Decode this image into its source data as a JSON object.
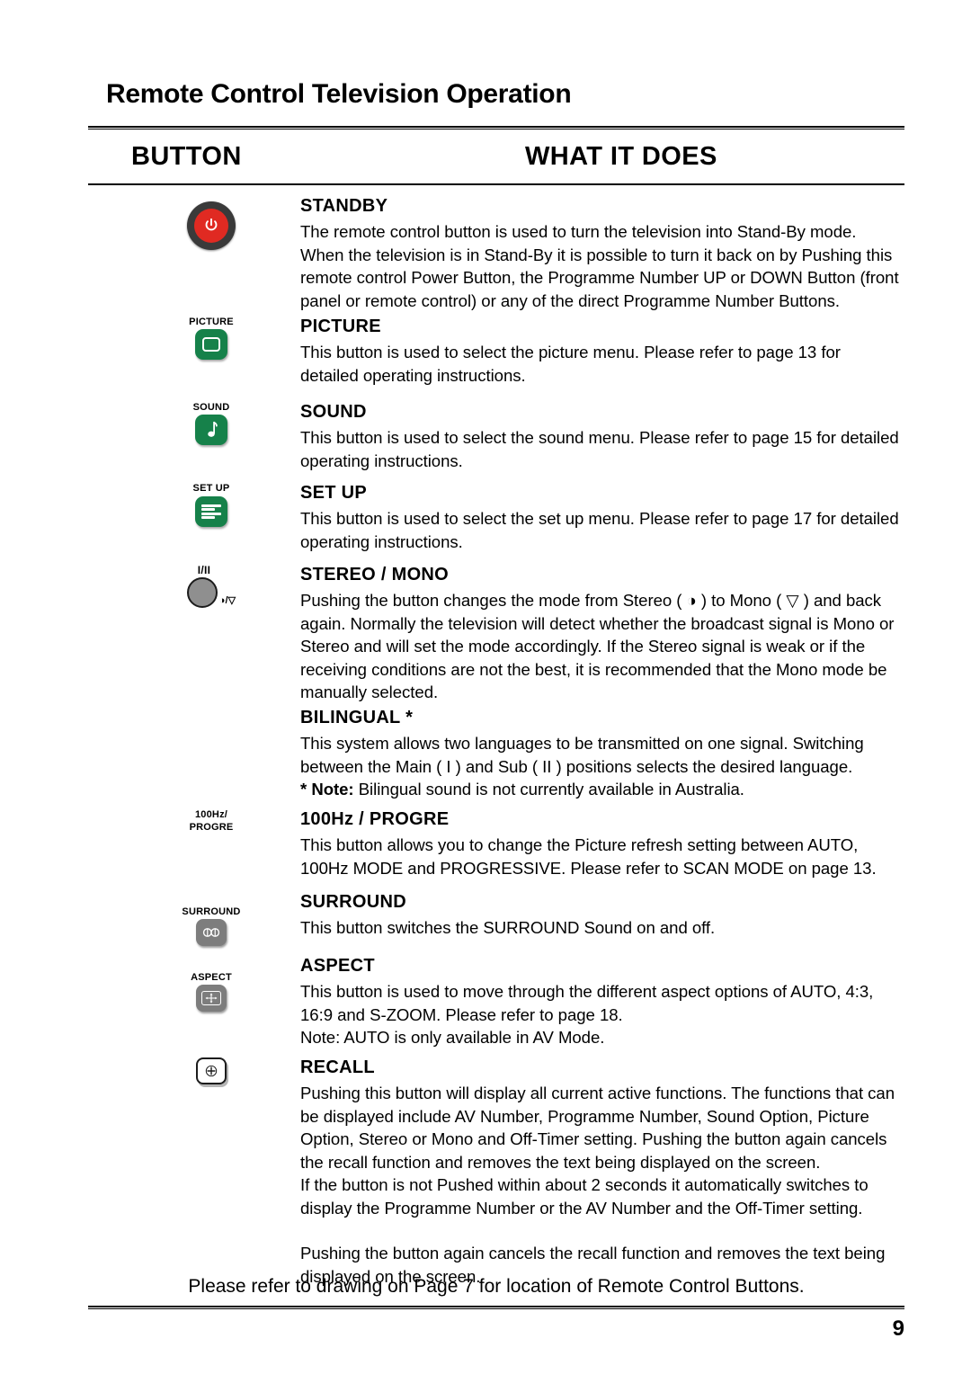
{
  "header": {
    "title": "Remote Control Television Operation",
    "column_button": "BUTTON",
    "column_what": "WHAT IT DOES"
  },
  "sections": [
    {
      "id": "standby",
      "title": "STANDBY",
      "icon": "power-button-icon",
      "icon_label": "",
      "body": "The remote control button is used to turn the television into Stand-By mode. When the television is in Stand-By it is possible to turn it back on by Pushing this remote control Power Button, the Programme Number UP or DOWN Button (front panel or remote control) or any of the direct Programme Number Buttons."
    },
    {
      "id": "picture",
      "title": "PICTURE",
      "icon": "picture-button-icon",
      "icon_label": "PICTURE",
      "body": "This button is used to select the picture menu. Please refer to page 13 for detailed operating instructions."
    },
    {
      "id": "sound",
      "title": "SOUND",
      "icon": "sound-button-icon",
      "icon_label": "SOUND",
      "body": "This button is used to select the sound menu. Please refer to page 15 for detailed operating instructions."
    },
    {
      "id": "setup",
      "title": "SET UP",
      "icon": "setup-button-icon",
      "icon_label": "SET UP",
      "body": "This button is used to select the set up menu. Please refer to page 17 for detailed operating instructions."
    },
    {
      "id": "stereo-mono",
      "title": "STEREO / MONO",
      "icon": "stereo-mono-button-icon",
      "icon_label": "I/II",
      "icon_sublabel": "◑/▽",
      "body_pre": "Pushing the button changes the mode from Stereo ( ",
      "stereo_symbol": "◑",
      "body_mid": " ) to Mono ( ",
      "mono_symbol": "▽",
      "body_post": " ) and back again. Normally the television will detect whether the broadcast signal is Mono or Stereo and will set the mode accordingly. If the Stereo signal is weak or if the receiving conditions are not the best, it is recommended that the Mono mode be manually selected."
    },
    {
      "id": "bilingual",
      "title": "BILINGUAL *",
      "icon": "",
      "icon_label": "",
      "body": "This system allows two languages to be transmitted on one signal. Switching between the Main ( I ) and Sub ( II ) positions selects the desired language.",
      "note_marker": "* ",
      "note_label": "Note:",
      "note_text": " Bilingual sound is not currently available in Australia."
    },
    {
      "id": "hundred-hz-progre",
      "title": "100Hz / PROGRE",
      "icon": "progressive-button-icon",
      "icon_label_line1": "100Hz/",
      "icon_label_line2": "PROGRE",
      "body": "This button allows you to change the Picture refresh setting between AUTO, 100Hz MODE and PROGRESSIVE. Please refer to SCAN MODE on page 13."
    },
    {
      "id": "surround",
      "title": "SURROUND",
      "icon": "surround-button-icon",
      "icon_label": "SURROUND",
      "body": "This button switches the SURROUND Sound on and off."
    },
    {
      "id": "aspect",
      "title": "ASPECT",
      "icon": "aspect-button-icon",
      "icon_label": "ASPECT",
      "body_line1": "This button is used to move through the different aspect options of AUTO, 4:3,",
      "body_line2": "16:9 and S-ZOOM. Please refer to page 18.",
      "body_line3": "Note: AUTO is only available in AV Mode."
    },
    {
      "id": "recall",
      "title": "RECALL",
      "icon": "recall-button-icon",
      "icon_label": "",
      "body_para1": "Pushing this button will display all current active functions. The functions that can be displayed include AV Number, Programme Number, Sound Option, Picture Option, Stereo or Mono and Off-Timer setting. Pushing the button again cancels the recall function and removes the text being displayed on the screen.",
      "body_para2": "If the button is not Pushed within about 2 seconds it automatically switches to display the Programme Number or the AV Number and the Off-Timer setting.",
      "body_para3": "Pushing the button again cancels the recall function and removes the text being displayed on the screen."
    }
  ],
  "footer": {
    "note": "Please refer to drawing on Page 7 for location of Remote Control Buttons.",
    "page_number": "9"
  },
  "colors": {
    "standby_red": "#e02a22",
    "green_button": "#16814a",
    "grey_button": "#7d7d7d",
    "dark_button": "#1b1412"
  }
}
